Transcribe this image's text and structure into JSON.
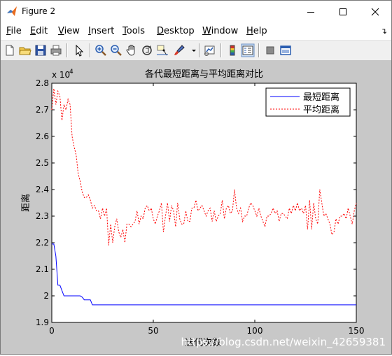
{
  "window": {
    "title": "Figure 2"
  },
  "menu": [
    {
      "label": "File",
      "key": "F",
      "rest": "ile"
    },
    {
      "label": "Edit",
      "key": "E",
      "rest": "dit"
    },
    {
      "label": "View",
      "key": "V",
      "rest": "iew"
    },
    {
      "label": "Insert",
      "key": "I",
      "rest": "nsert"
    },
    {
      "label": "Tools",
      "key": "T",
      "rest": "ools"
    },
    {
      "label": "Desktop",
      "key": "D",
      "rest": "esktop"
    },
    {
      "label": "Window",
      "key": "W",
      "rest": "indow"
    },
    {
      "label": "Help",
      "key": "H",
      "rest": "elp"
    }
  ],
  "toolbar": {
    "icons": [
      "new-figure-icon",
      "open-file-icon",
      "save-icon",
      "print-icon",
      "pointer-icon",
      "zoom-in-icon",
      "zoom-out-icon",
      "pan-hand-icon",
      "rotate-3d-icon",
      "data-cursor-icon",
      "brush-icon",
      "link-plot-icon",
      "colorbar-icon",
      "legend-icon",
      "hide-plot-tools-icon",
      "show-plot-tools-icon"
    ]
  },
  "chart_data": {
    "type": "line",
    "title": "各代最短距离与平均距离对比",
    "xlabel": "迭代次数",
    "ylabel": "距离",
    "exponent_label": "x 10",
    "exponent_power": "4",
    "xlim": [
      0,
      150
    ],
    "ylim": [
      1.9,
      2.8
    ],
    "xticks": [
      "0",
      "50",
      "100",
      "150"
    ],
    "yticks": [
      "1.9",
      "2",
      "2.1",
      "2.2",
      "2.3",
      "2.4",
      "2.5",
      "2.6",
      "2.7",
      "2.8"
    ],
    "legend_position": "top-right",
    "series": [
      {
        "name": "最短距离",
        "color": "#0000ff",
        "style": "solid",
        "values": [
          2.195,
          2.195,
          2.15,
          2.04,
          2.04,
          2.02,
          2.0,
          2.0,
          2.0,
          2.0,
          2.0,
          2.0,
          2.0,
          2.0,
          2.0,
          1.995,
          1.985,
          1.985,
          1.985,
          1.985,
          1.966,
          1.966,
          1.966,
          1.966,
          1.966,
          1.966,
          1.966,
          1.966,
          1.966,
          1.966,
          1.966,
          1.966,
          1.966,
          1.966,
          1.966,
          1.966,
          1.966,
          1.966,
          1.966,
          1.966,
          1.966,
          1.966,
          1.966,
          1.966,
          1.966,
          1.966,
          1.966,
          1.966,
          1.966,
          1.966,
          1.966,
          1.966,
          1.966,
          1.966,
          1.966,
          1.966,
          1.966,
          1.966,
          1.966,
          1.966,
          1.966,
          1.966,
          1.966,
          1.966,
          1.966,
          1.966,
          1.966,
          1.966,
          1.966,
          1.966,
          1.966,
          1.966,
          1.966,
          1.966,
          1.966,
          1.966,
          1.966,
          1.966,
          1.966,
          1.966,
          1.966,
          1.966,
          1.966,
          1.966,
          1.966,
          1.966,
          1.966,
          1.966,
          1.966,
          1.966,
          1.966,
          1.966,
          1.966,
          1.966,
          1.966,
          1.966,
          1.966,
          1.966,
          1.966,
          1.966,
          1.966,
          1.966,
          1.966,
          1.966,
          1.966,
          1.966,
          1.966,
          1.966,
          1.966,
          1.966,
          1.966,
          1.966,
          1.966,
          1.966,
          1.966,
          1.966,
          1.966,
          1.966,
          1.966,
          1.966,
          1.966,
          1.966,
          1.966,
          1.966,
          1.966,
          1.966,
          1.966,
          1.966,
          1.966,
          1.966,
          1.966,
          1.966,
          1.966,
          1.966,
          1.966,
          1.966,
          1.966,
          1.966,
          1.966,
          1.966,
          1.966,
          1.966,
          1.966,
          1.966,
          1.966,
          1.966,
          1.966,
          1.966,
          1.966,
          1.966,
          1.966
        ]
      },
      {
        "name": "平均距离",
        "color": "#ff0000",
        "style": "dashed",
        "values": [
          2.7,
          2.78,
          2.72,
          2.77,
          2.75,
          2.66,
          2.72,
          2.7,
          2.74,
          2.72,
          2.6,
          2.56,
          2.53,
          2.46,
          2.43,
          2.39,
          2.37,
          2.37,
          2.38,
          2.36,
          2.33,
          2.34,
          2.32,
          2.32,
          2.29,
          2.33,
          2.3,
          2.33,
          2.19,
          2.27,
          2.2,
          2.26,
          2.29,
          2.24,
          2.22,
          2.25,
          2.2,
          2.27,
          2.27,
          2.26,
          2.27,
          2.28,
          2.32,
          2.27,
          2.3,
          2.29,
          2.33,
          2.34,
          2.32,
          2.33,
          2.29,
          2.27,
          2.3,
          2.32,
          2.35,
          2.24,
          2.3,
          2.35,
          2.28,
          2.34,
          2.32,
          2.26,
          2.35,
          2.29,
          2.27,
          2.27,
          2.32,
          2.28,
          2.28,
          2.33,
          2.33,
          2.36,
          2.32,
          2.33,
          2.34,
          2.32,
          2.3,
          2.32,
          2.33,
          2.28,
          2.32,
          2.28,
          2.3,
          2.31,
          2.36,
          2.29,
          2.33,
          2.34,
          2.31,
          2.32,
          2.4,
          2.33,
          2.31,
          2.33,
          2.28,
          2.3,
          2.3,
          2.33,
          2.35,
          2.34,
          2.32,
          2.3,
          2.33,
          2.3,
          2.28,
          2.26,
          2.3,
          2.3,
          2.31,
          2.33,
          2.31,
          2.32,
          2.28,
          2.31,
          2.31,
          2.3,
          2.29,
          2.33,
          2.31,
          2.34,
          2.32,
          2.35,
          2.32,
          2.33,
          2.31,
          2.34,
          2.25,
          2.36,
          2.25,
          2.35,
          2.29,
          2.27,
          2.4,
          2.35,
          2.3,
          2.31,
          2.29,
          2.27,
          2.23,
          2.24,
          2.29,
          2.27,
          2.3,
          2.3,
          2.31,
          2.29,
          2.33,
          2.3,
          2.27,
          2.32,
          2.35
        ]
      }
    ]
  },
  "watermark": "https://blog.csdn.net/weixin_42659381"
}
